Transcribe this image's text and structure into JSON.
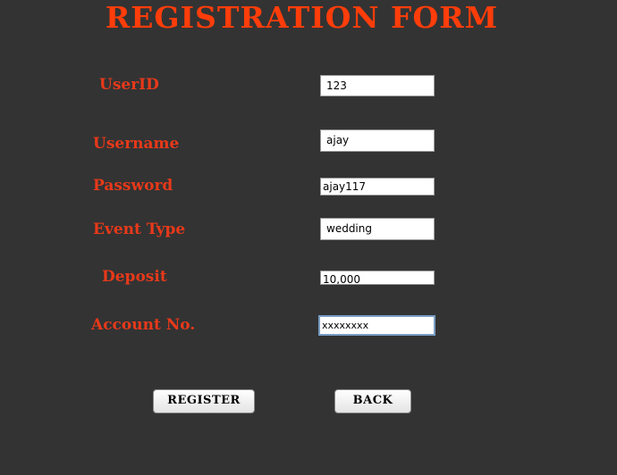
{
  "title": "REGISTRATION FORM",
  "fields": {
    "userid": {
      "label": "UserID",
      "value": "123"
    },
    "username": {
      "label": "Username",
      "value": "ajay"
    },
    "password": {
      "label": "Password",
      "value": "ajay117"
    },
    "event_type": {
      "label": "Event Type",
      "value": "wedding"
    },
    "deposit": {
      "label": "Deposit",
      "value": "10,000"
    },
    "account_no": {
      "label": "Account No.",
      "value": "xxxxxxxx"
    }
  },
  "buttons": {
    "register": "REGISTER",
    "back": "BACK"
  },
  "colors": {
    "background": "#333333",
    "label": "#e8391a",
    "title": "#ff3d0a"
  }
}
